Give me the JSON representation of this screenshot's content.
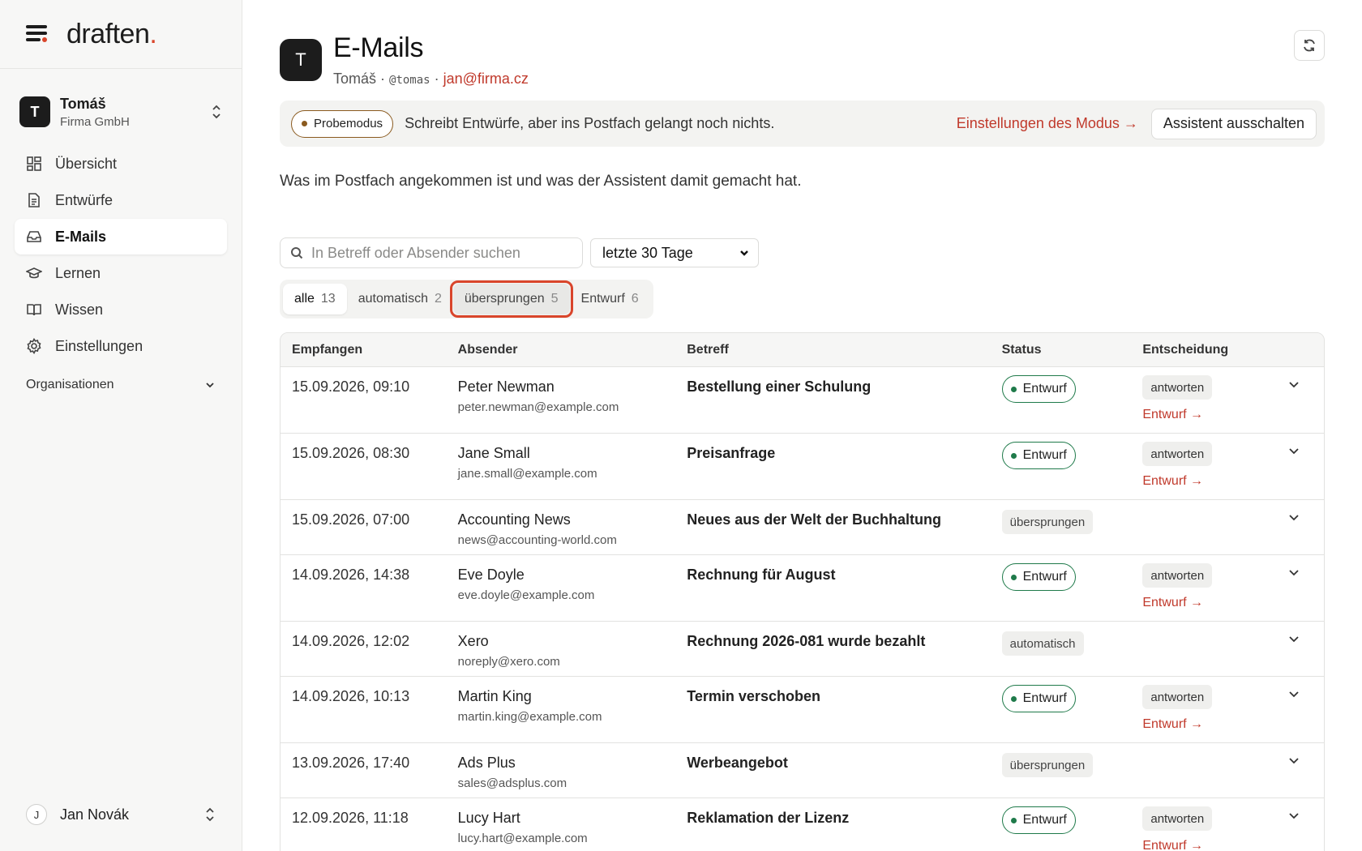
{
  "brand": {
    "name": "draften",
    "dot": "."
  },
  "org": {
    "initial": "T",
    "name": "Tomáš",
    "company": "Firma GmbH"
  },
  "nav": [
    {
      "label": "Übersicht",
      "icon": "dashboard-icon"
    },
    {
      "label": "Entwürfe",
      "icon": "document-icon"
    },
    {
      "label": "E-Mails",
      "icon": "inbox-icon",
      "active": true
    },
    {
      "label": "Lernen",
      "icon": "graduation-cap-icon"
    },
    {
      "label": "Wissen",
      "icon": "book-icon"
    },
    {
      "label": "Einstellungen",
      "icon": "gear-icon"
    }
  ],
  "section_org": "Organisationen",
  "user": {
    "initial": "J",
    "name": "Jan Novák"
  },
  "header": {
    "initial": "T",
    "title": "E-Mails",
    "name": "Tomáš",
    "sep": " · ",
    "handle": "@tomas",
    "email": "jan@firma.cz"
  },
  "banner": {
    "mode": "Probemodus",
    "text": "Schreibt Entwürfe, aber ins Postfach gelangt noch nichts.",
    "link": "Einstellungen des Modus →",
    "button": "Assistent ausschalten"
  },
  "intro": "Was im Postfach angekommen ist und was der Assistent damit gemacht hat.",
  "search": {
    "placeholder": "In Betreff oder Absender suchen"
  },
  "range": {
    "selected": "letzte 30 Tage"
  },
  "tabs": [
    {
      "label": "alle",
      "count": "13"
    },
    {
      "label": "automatisch",
      "count": "2"
    },
    {
      "label": "übersprungen",
      "count": "5"
    },
    {
      "label": "Entwurf",
      "count": "6"
    }
  ],
  "table": {
    "headers": [
      "Empfangen",
      "Absender",
      "Betreff",
      "Status",
      "Entscheidung"
    ],
    "rows": [
      {
        "received": "15.09.2026, 09:10",
        "sender": "Peter Newman",
        "email": "peter.newman@example.com",
        "subject": "Bestellung einer Schulung",
        "status": "Entwurf",
        "decision": "antworten",
        "link": "Entwurf →"
      },
      {
        "received": "15.09.2026, 08:30",
        "sender": "Jane Small",
        "email": "jane.small@example.com",
        "subject": "Preisanfrage",
        "status": "Entwurf",
        "decision": "antworten",
        "link": "Entwurf →"
      },
      {
        "received": "15.09.2026, 07:00",
        "sender": "Accounting News",
        "email": "news@accounting-world.com",
        "subject": "Neues aus der Welt der Buchhaltung",
        "status": "übersprungen"
      },
      {
        "received": "14.09.2026, 14:38",
        "sender": "Eve Doyle",
        "email": "eve.doyle@example.com",
        "subject": "Rechnung für August",
        "status": "Entwurf",
        "decision": "antworten",
        "link": "Entwurf →"
      },
      {
        "received": "14.09.2026, 12:02",
        "sender": "Xero",
        "email": "noreply@xero.com",
        "subject": "Rechnung 2026-081 wurde bezahlt",
        "status": "automatisch"
      },
      {
        "received": "14.09.2026, 10:13",
        "sender": "Martin King",
        "email": "martin.king@example.com",
        "subject": "Termin verschoben",
        "status": "Entwurf",
        "decision": "antworten",
        "link": "Entwurf →"
      },
      {
        "received": "13.09.2026, 17:40",
        "sender": "Ads Plus",
        "email": "sales@adsplus.com",
        "subject": "Werbeangebot",
        "status": "übersprungen"
      },
      {
        "received": "12.09.2026, 11:18",
        "sender": "Lucy Hart",
        "email": "lucy.hart@example.com",
        "subject": "Reklamation der Lizenz",
        "status": "Entwurf",
        "decision": "antworten",
        "link": "Entwurf →"
      }
    ]
  },
  "colors": {
    "accent": "#d9452b",
    "link": "#c0392b",
    "draft": "#1f7a4a",
    "mode": "#8a5a1f"
  }
}
